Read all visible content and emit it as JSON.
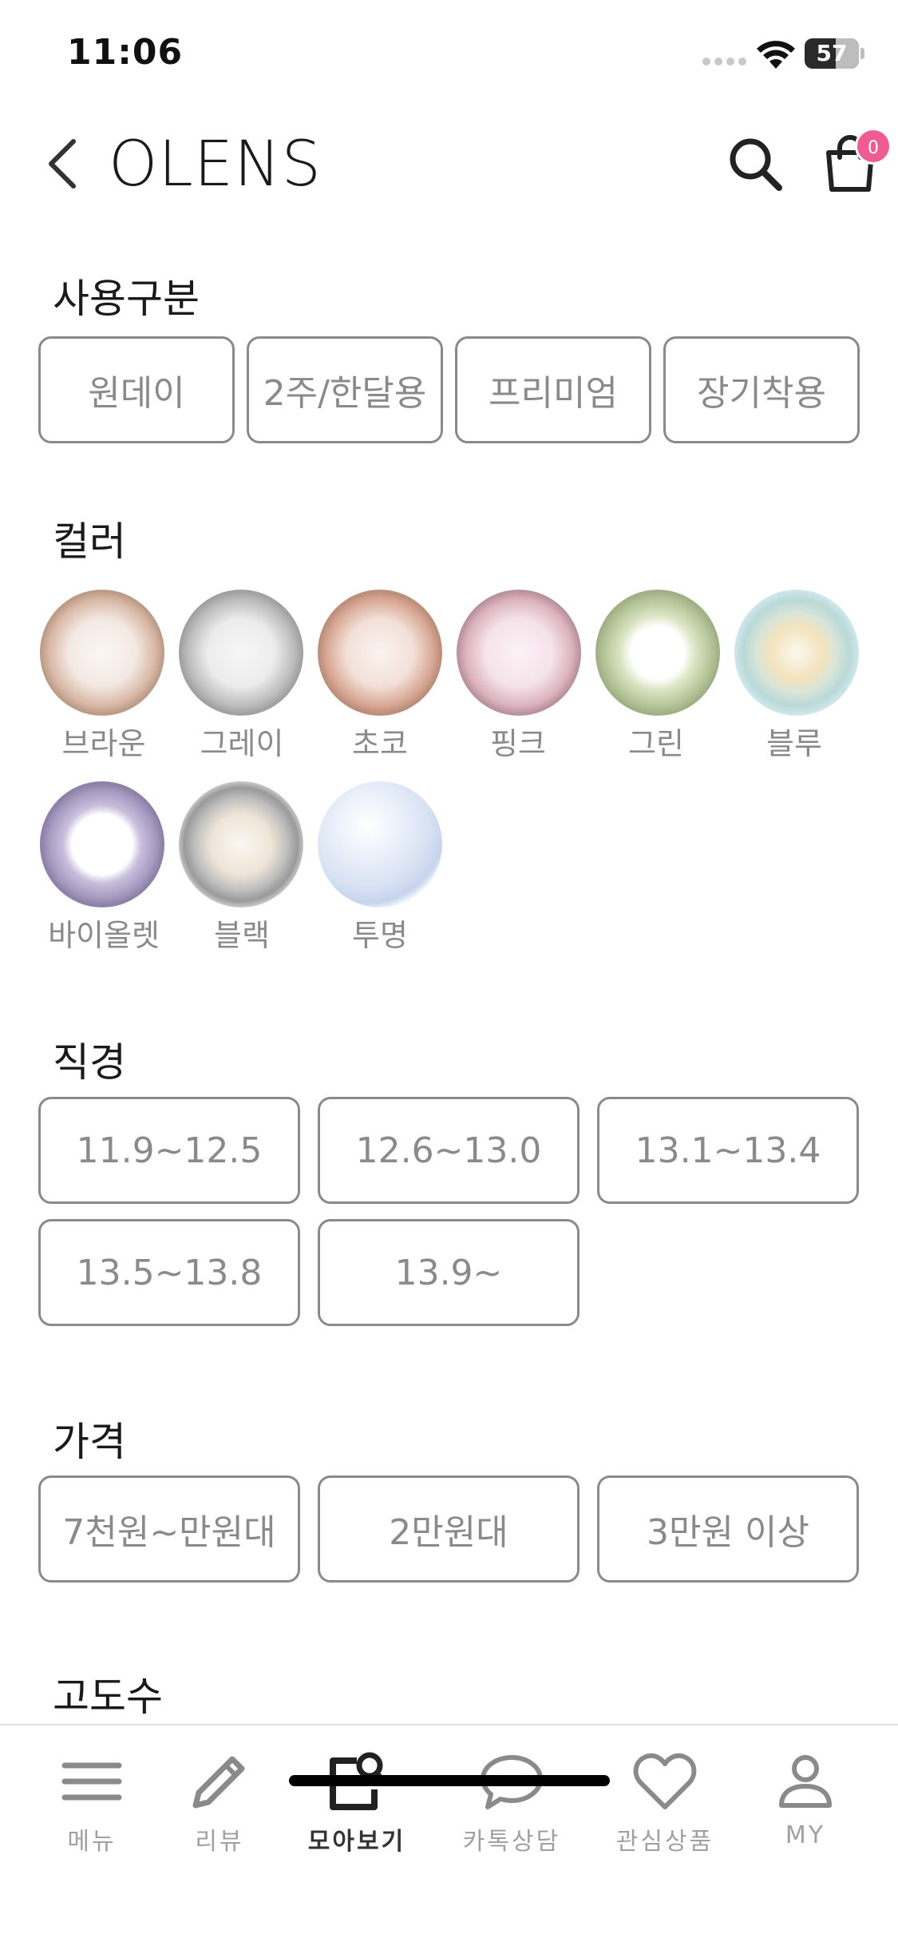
{
  "status_bar": {
    "time": "11:06",
    "battery": "57",
    "battery_level": 0.57
  },
  "header": {
    "logo": "OLENS",
    "cart_count": "0"
  },
  "sections": {
    "usage": {
      "title": "사용구분",
      "options": [
        "원데이",
        "2주/한달용",
        "프리미엄",
        "장기착용"
      ]
    },
    "color": {
      "title": "컬러",
      "options": [
        {
          "label": "브라운",
          "color": "#d9b8a6"
        },
        {
          "label": "그레이",
          "color": "#b9b9b9"
        },
        {
          "label": "초코",
          "color": "#d8a894"
        },
        {
          "label": "핑크",
          "color": "#dcb3bf"
        },
        {
          "label": "그린",
          "color": "#b7c59a"
        },
        {
          "label": "블루",
          "color": "#b9d9d8"
        },
        {
          "label": "바이올렛",
          "color": "#a79bc0"
        },
        {
          "label": "블랙",
          "color": "#9a9a9a"
        },
        {
          "label": "투명",
          "color": "#d7e2f3"
        }
      ]
    },
    "diameter": {
      "title": "직경",
      "options": [
        "11.9~12.5",
        "12.6~13.0",
        "13.1~13.4",
        "13.5~13.8",
        "13.9~"
      ]
    },
    "price": {
      "title": "가격",
      "options": [
        "7천원~만원대",
        "2만원대",
        "3만원 이상"
      ]
    },
    "power": {
      "title": "고도수"
    }
  },
  "bottom_nav": [
    {
      "label": "메뉴",
      "icon": "menu-icon"
    },
    {
      "label": "리뷰",
      "icon": "pencil-icon"
    },
    {
      "label": "모아보기",
      "icon": "browse-icon",
      "active": true
    },
    {
      "label": "카톡상담",
      "icon": "chat-icon"
    },
    {
      "label": "관심상품",
      "icon": "heart-icon"
    },
    {
      "label": "MY",
      "icon": "person-icon"
    }
  ],
  "colors": {
    "chip_border": "#8a8a8a",
    "badge": "#ef5c93"
  }
}
